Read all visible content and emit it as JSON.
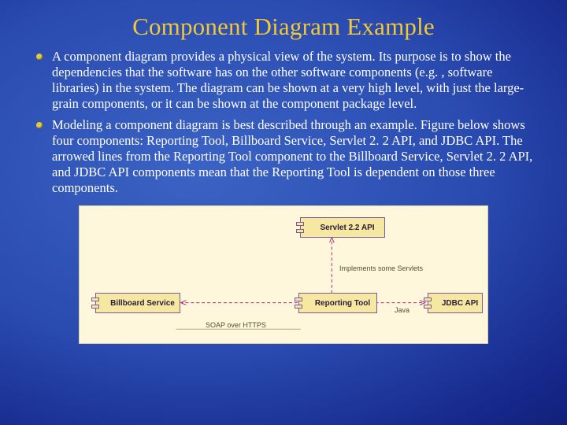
{
  "title": "Component Diagram Example",
  "bullets": [
    "A component diagram provides a physical view of the system. Its purpose is to show the dependencies that the software has on the other software components (e.g. , software libraries) in the system. The diagram can be shown at a very high level, with just the large-grain components, or it can be shown at the component package level.",
    "Modeling a component diagram is best described through an example. Figure below shows four components: Reporting Tool, Billboard Service, Servlet 2. 2 API, and JDBC API. The arrowed lines from the Reporting Tool component to the Billboard Service, Servlet 2. 2 API, and JDBC API components mean that the Reporting Tool is dependent on those three components."
  ],
  "diagram": {
    "components": {
      "servlet": "Servlet 2.2 API",
      "billboard": "Billboard Service",
      "reporting": "Reporting Tool",
      "jdbc": "JDBC API"
    },
    "labels": {
      "implements": "Implements some Servlets",
      "soap": "SOAP over HTTPS",
      "java": "Java"
    }
  }
}
